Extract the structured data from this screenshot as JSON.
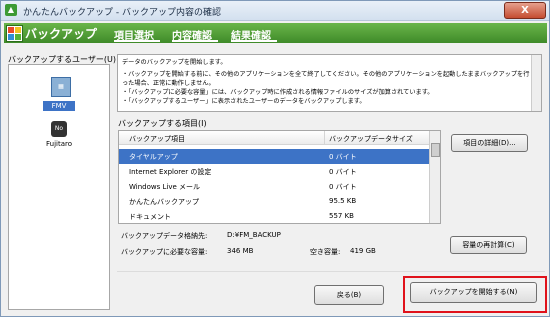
{
  "window": {
    "title": "かんたんバックアップ - バックアップ内容の確認",
    "close_label": "X"
  },
  "header": {
    "title": "バックアップ",
    "tabs": [
      {
        "label": "項目選択"
      },
      {
        "label": "内容確認"
      },
      {
        "label": "結果確認"
      }
    ]
  },
  "users": {
    "label": "バックアップするユーザー(U)",
    "items": [
      {
        "label": "FMV",
        "selected": true
      },
      {
        "label": "Fujitaro",
        "selected": false
      }
    ]
  },
  "description": {
    "lines": [
      "データのバックアップを開始します。",
      "・バックアップを開始する前に、その他のアプリケーションを全て終了してください。その他のアプリケーションを起動したままバックアップを行った場合、正常に動作しません。",
      "・「バックアップに必要な容量」には、バックアップ時に作成される情報ファイルのサイズが加算されています。",
      "・「バックアップするユーザー」に表示されたユーザーのデータをバックアップします。"
    ]
  },
  "items": {
    "label": "バックアップする項目(I)",
    "columns": [
      "バックアップ項目",
      "バックアップデータサイズ"
    ],
    "rows": [
      {
        "name": "タイヤルアップ",
        "size": "0 バイト",
        "selected": true
      },
      {
        "name": "Internet Explorer の設定",
        "size": "0 バイト"
      },
      {
        "name": "Windows Live メール",
        "size": "0 バイト"
      },
      {
        "name": "かんたんバックアップ",
        "size": "95.5 KB"
      },
      {
        "name": "ドキュメント",
        "size": "557 KB"
      }
    ],
    "details_button": "項目の詳細(D)..."
  },
  "info": {
    "location_label": "バックアップデータ格納先:",
    "location_value": "D:¥FM_BACKUP",
    "required_label": "バックアップに必要な容量:",
    "required_value": "346 MB",
    "free_label": "空き容量:",
    "free_value": "419 GB",
    "recalc_button": "容量の再計算(C)"
  },
  "footer": {
    "back_button": "戻る(B)",
    "start_button": "バックアップを開始する(N)"
  },
  "colors": {
    "accent_green": "#4c9e33",
    "selection_blue": "#3d73c6",
    "highlight_red": "#e0121b"
  }
}
